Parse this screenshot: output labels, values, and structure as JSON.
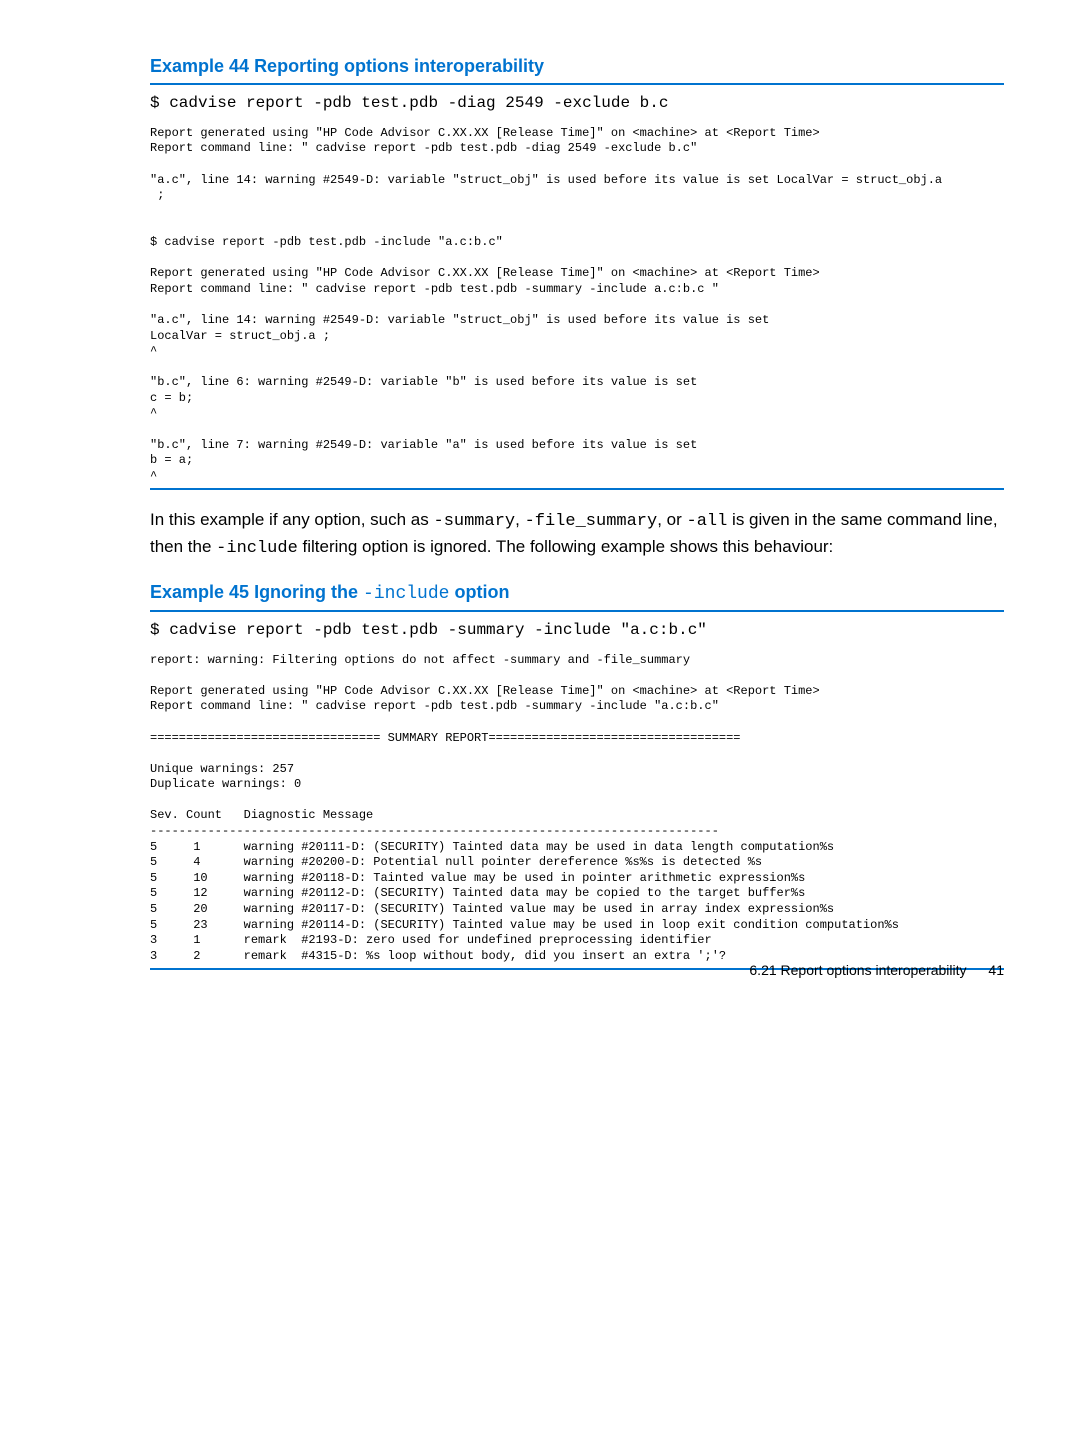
{
  "example44": {
    "heading": "Example 44 Reporting options interoperability",
    "cmd": "$ cadvise report -pdb test.pdb -diag 2549 -exclude b.c",
    "body": "Report generated using \"HP Code Advisor C.XX.XX [Release Time]\" on <machine> at <Report Time>\nReport command line: \" cadvise report -pdb test.pdb -diag 2549 -exclude b.c\"\n\n\"a.c\", line 14: warning #2549-D: variable \"struct_obj\" is used before its value is set LocalVar = struct_obj.a\n ;\n\n\n$ cadvise report -pdb test.pdb -include \"a.c:b.c\"\n\nReport generated using \"HP Code Advisor C.XX.XX [Release Time]\" on <machine> at <Report Time>\nReport command line: \" cadvise report -pdb test.pdb -summary -include a.c:b.c \"\n\n\"a.c\", line 14: warning #2549-D: variable \"struct_obj\" is used before its value is set\nLocalVar = struct_obj.a ;\n^\n\n\"b.c\", line 6: warning #2549-D: variable \"b\" is used before its value is set\nc = b;\n^\n\n\"b.c\", line 7: warning #2549-D: variable \"a\" is used before its value is set\nb = a;\n^"
  },
  "paragraph": {
    "pre": "In this example if any option, such as ",
    "m1": "-summary",
    "sep1": ", ",
    "m2": "-file_summary",
    "sep2": ", or ",
    "m3": "-all",
    "mid": " is given in the same command line, then the ",
    "m4": "-include",
    "post": " filtering option is ignored. The following example shows this behaviour:"
  },
  "example45": {
    "heading_pre": "Example 45 Ignoring the ",
    "heading_mono": "-include",
    "heading_post": " option",
    "cmd": "$ cadvise report -pdb test.pdb -summary -include \"a.c:b.c\"",
    "body": "report: warning: Filtering options do not affect -summary and -file_summary\n\nReport generated using \"HP Code Advisor C.XX.XX [Release Time]\" on <machine> at <Report Time>\nReport command line: \" cadvise report -pdb test.pdb -summary -include \"a.c:b.c\"\n\n================================ SUMMARY REPORT===================================\n\nUnique warnings: 257\nDuplicate warnings: 0\n\nSev. Count   Diagnostic Message\n-------------------------------------------------------------------------------\n5     1      warning #20111-D: (SECURITY) Tainted data may be used in data length computation%s\n5     4      warning #20200-D: Potential null pointer dereference %s%s is detected %s\n5     10     warning #20118-D: Tainted value may be used in pointer arithmetic expression%s\n5     12     warning #20112-D: (SECURITY) Tainted data may be copied to the target buffer%s\n5     20     warning #20117-D: (SECURITY) Tainted value may be used in array index expression%s\n5     23     warning #20114-D: (SECURITY) Tainted value may be used in loop exit condition computation%s\n3     1      remark  #2193-D: zero used for undefined preprocessing identifier\n3     2      remark  #4315-D: %s loop without body, did you insert an extra ';'?"
  },
  "footer": {
    "section": "6.21 Report options interoperability",
    "page": "41"
  }
}
